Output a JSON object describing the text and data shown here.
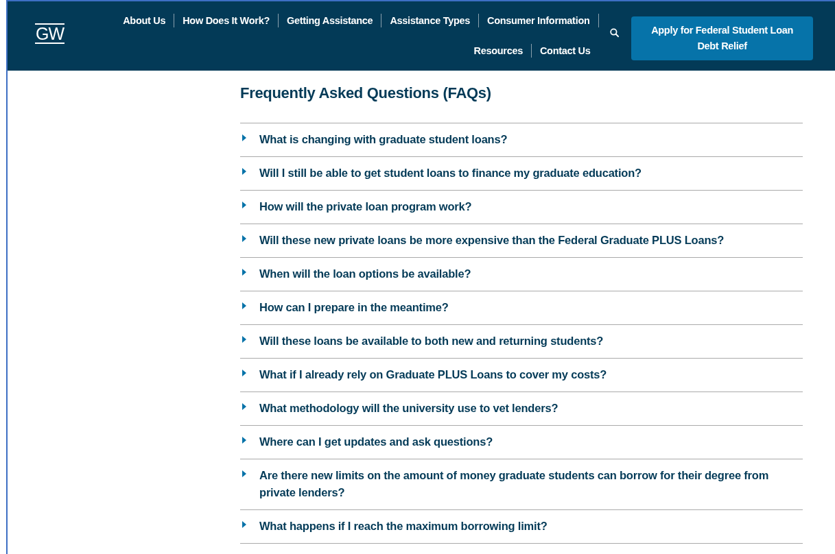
{
  "header": {
    "logo": "GW",
    "nav": [
      "About Us",
      "How Does It Work?",
      "Getting Assistance",
      "Assistance Types",
      "Consumer Information",
      "Resources",
      "Contact Us"
    ],
    "cta": "Apply for Federal Student Loan Debt Relief"
  },
  "faq": {
    "title": "Frequently Asked Questions (FAQs)",
    "items": [
      {
        "question": "What is changing with graduate student loans?",
        "expanded": false
      },
      {
        "question": "Will I still be able to get student loans to finance my graduate education?",
        "expanded": false
      },
      {
        "question": "How will the private loan program work?",
        "expanded": false
      },
      {
        "question": "Will these new private loans be more expensive than the Federal Graduate PLUS Loans?",
        "expanded": false
      },
      {
        "question": "When will the loan options be available?",
        "expanded": false
      },
      {
        "question": "How can I prepare in the meantime?",
        "expanded": false
      },
      {
        "question": "Will these loans be available to both new and returning students?",
        "expanded": false
      },
      {
        "question": "What if I already rely on Graduate PLUS Loans to cover my costs?",
        "expanded": false
      },
      {
        "question": "What methodology will the university use to vet lenders?",
        "expanded": false
      },
      {
        "question": "Where can I get updates and ask questions?",
        "expanded": false
      },
      {
        "question": "Are there new limits on the amount of money graduate students can borrow for their degree from private lenders?",
        "expanded": false
      },
      {
        "question": "What happens if I reach the maximum borrowing limit?",
        "expanded": false
      }
    ]
  }
}
